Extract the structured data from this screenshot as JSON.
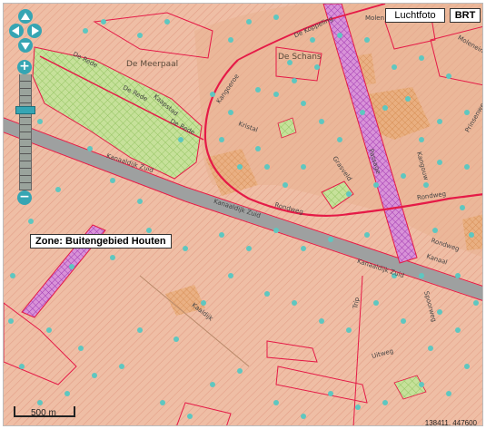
{
  "layer_buttons": {
    "aerial": "Luchtfoto",
    "topo": "BRT"
  },
  "zone_label": "Zone: Buitengebied Houten",
  "scale": {
    "text": "500 m"
  },
  "coordinates": "138411, 447600",
  "navigation": {
    "pan": [
      "pan-up",
      "pan-left",
      "pan-right",
      "pan-down"
    ],
    "zoom_in": "+",
    "zoom_out": "−"
  },
  "colors": {
    "background": "#efbea5",
    "hatch": "#e8a98f",
    "boundary": "#e51a47",
    "green_zone": "#bfdf8c",
    "purple_zone": "#c34fd0",
    "orange_zone": "#e59a5a",
    "teal_dot": "#5ec7c0",
    "road": "#a9a9a9"
  },
  "map_labels": {
    "district_meerpaal": "De Meerpaal",
    "district_schans": "De Schans",
    "de_rede_1": "De Rede",
    "de_rede_2": "De Rede",
    "de_rede_3": "De Rede",
    "kangoeroe": "Kangoeroe",
    "kaapstad": "Kaapstad",
    "kristal": "Kristal",
    "kanaaldijk_zuid": "Kanaaldijk Zuid",
    "kanaaldijk_zuid_2": "Kanaaldijk Zuid",
    "kanaaldijk_zuid_3": "Kanaaldijk Zuid",
    "kaaldijk": "Kaaldijk",
    "rondweg": "Rondweg",
    "rondweg_2": "Rondweg",
    "rondweg_3": "Rondweg",
    "de_koppeling": "De Koppeling",
    "molen": "Molen",
    "trip": "Trip",
    "uitweg": "Uitweg",
    "spoorweg": "Spoorweg",
    "grasveld": "Grasveld",
    "passage": "Passage",
    "kangouw": "Kangouw",
    "prinsenweg": "Prinsenweg",
    "moleneind": "Moleneind",
    "kanaal": "Kanaal"
  }
}
